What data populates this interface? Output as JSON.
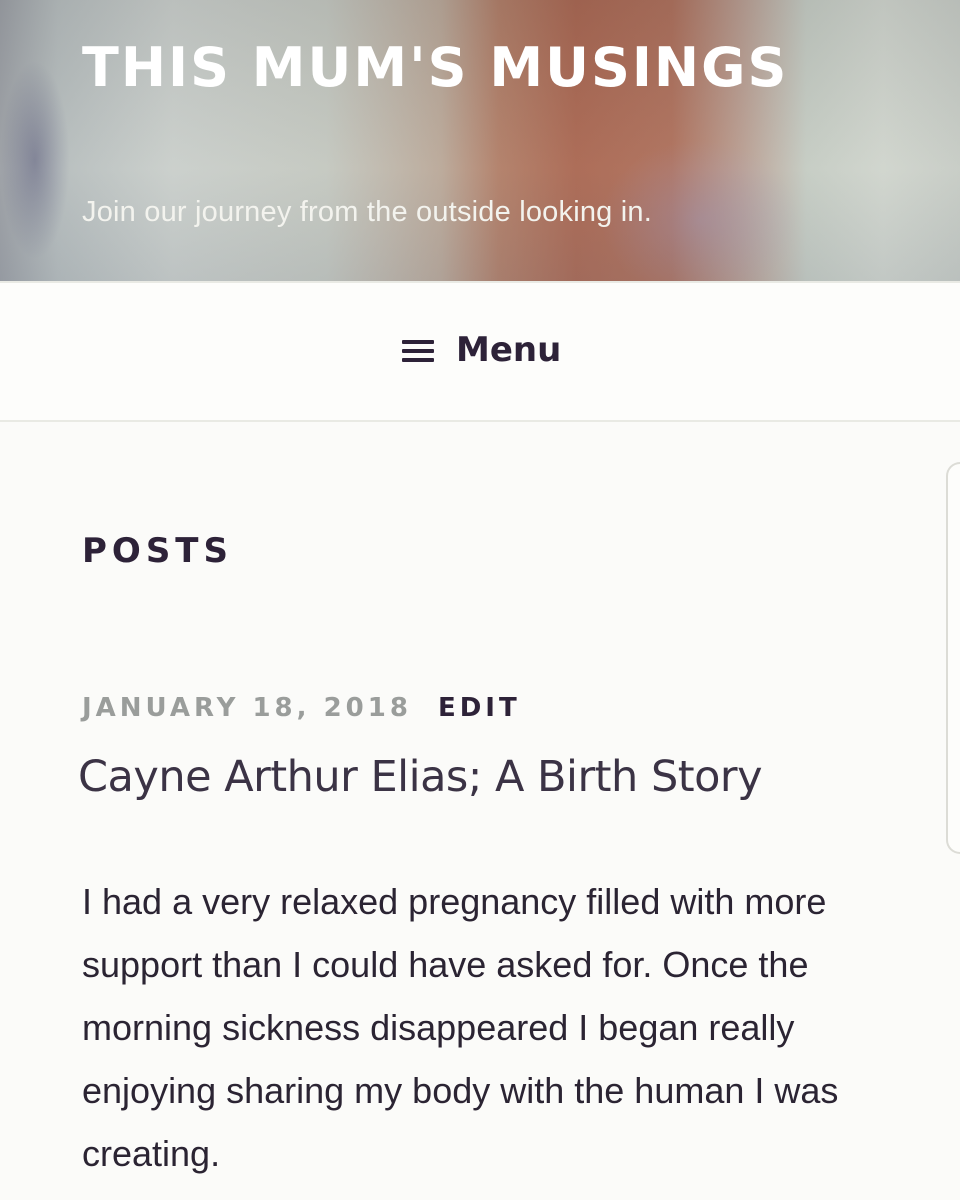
{
  "header": {
    "site_title": "THIS MUM'S MUSINGS",
    "tagline": "Join our journey from the outside looking in."
  },
  "nav": {
    "menu_icon": "hamburger-icon",
    "menu_label": "Menu"
  },
  "main": {
    "section_heading": "POSTS",
    "post": {
      "date": "JANUARY 18, 2018",
      "edit_label": "EDIT",
      "title": "Cayne Arthur Elias; A Birth Story",
      "excerpt": "I had a very relaxed pregnancy filled with more support than I could have asked for. Once the morning sickness disappeared I began really enjoying sharing my body with the human I was creating."
    }
  },
  "colors": {
    "text_dark": "#2d2238",
    "date_gray": "#9a9d9b",
    "background": "#fbfbf9"
  }
}
